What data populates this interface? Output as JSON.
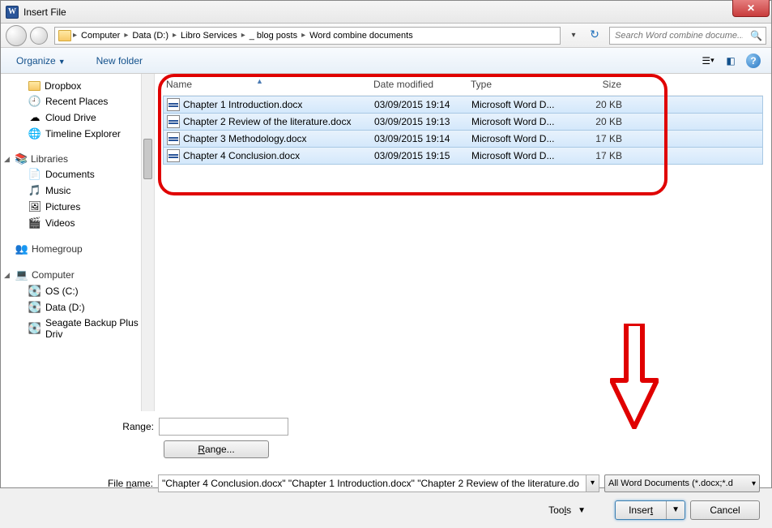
{
  "title": "Insert File",
  "breadcrumbs": [
    "Computer",
    "Data (D:)",
    "Libro Services",
    "_ blog posts",
    "Word combine documents"
  ],
  "search_placeholder": "Search Word combine docume...",
  "toolbar": {
    "organize": "Organize",
    "new_folder": "New folder"
  },
  "sidebar": {
    "favorites": [
      {
        "label": "Dropbox",
        "icon": "folder"
      },
      {
        "label": "Recent Places",
        "icon": "recent"
      },
      {
        "label": "Cloud Drive",
        "icon": "cloud"
      },
      {
        "label": "Timeline Explorer",
        "icon": "globe"
      }
    ],
    "libraries_label": "Libraries",
    "libraries": [
      {
        "label": "Documents",
        "icon": "doc"
      },
      {
        "label": "Music",
        "icon": "music"
      },
      {
        "label": "Pictures",
        "icon": "pic"
      },
      {
        "label": "Videos",
        "icon": "vid"
      }
    ],
    "homegroup": "Homegroup",
    "computer_label": "Computer",
    "drives": [
      {
        "label": "OS (C:)"
      },
      {
        "label": "Data (D:)"
      },
      {
        "label": "Seagate Backup Plus Driv"
      }
    ]
  },
  "columns": {
    "name": "Name",
    "date": "Date modified",
    "type": "Type",
    "size": "Size"
  },
  "files": [
    {
      "name": "Chapter 1 Introduction.docx",
      "date": "03/09/2015 19:14",
      "type": "Microsoft Word D...",
      "size": "20 KB"
    },
    {
      "name": "Chapter 2 Review of the literature.docx",
      "date": "03/09/2015 19:13",
      "type": "Microsoft Word D...",
      "size": "20 KB"
    },
    {
      "name": "Chapter 3 Methodology.docx",
      "date": "03/09/2015 19:14",
      "type": "Microsoft Word D...",
      "size": "17 KB"
    },
    {
      "name": "Chapter 4 Conclusion.docx",
      "date": "03/09/2015 19:15",
      "type": "Microsoft Word D...",
      "size": "17 KB"
    }
  ],
  "range_label": "Range:",
  "range_btn": "Range...",
  "filename_label": "File name:",
  "filename_value": "\"Chapter 4 Conclusion.docx\" \"Chapter 1 Introduction.docx\" \"Chapter 2 Review of the literature.do",
  "filetype": "All Word Documents (*.docx;*.d",
  "tools": "Tools",
  "insert": "Insert",
  "cancel": "Cancel"
}
